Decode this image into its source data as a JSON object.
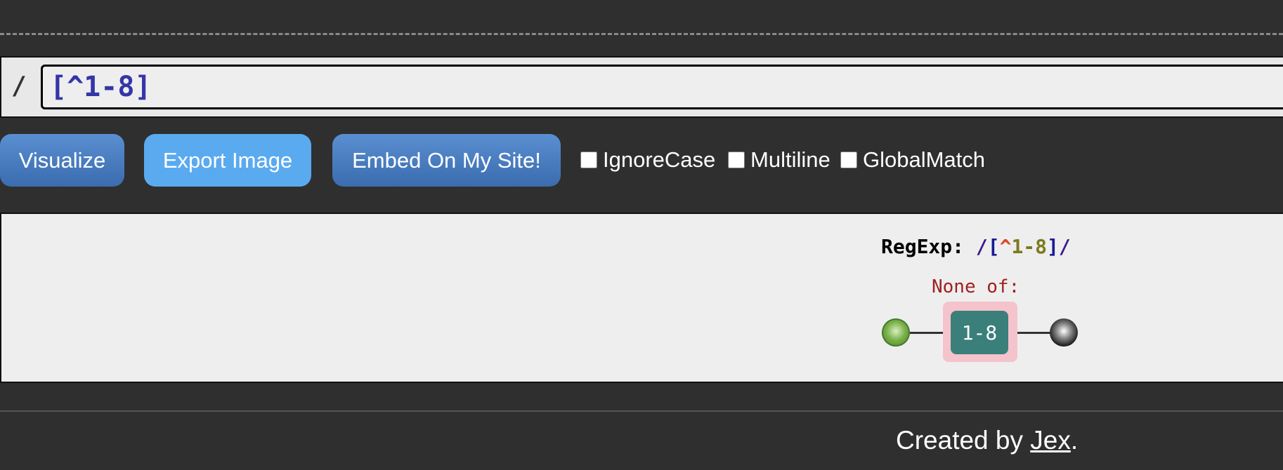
{
  "input": {
    "slash": "/",
    "value": "[^1-8]"
  },
  "buttons": {
    "visualize": "Visualize",
    "export": "Export Image",
    "embed": "Embed On My Site!"
  },
  "options": {
    "ignore_case": {
      "label": "IgnoreCase",
      "checked": false
    },
    "multiline": {
      "label": "Multiline",
      "checked": false
    },
    "global_match": {
      "label": "GlobalMatch",
      "checked": false
    }
  },
  "diagram": {
    "regexp_prefix": "RegExp: ",
    "open_slash": "/",
    "open_bracket": "[",
    "caret": "^",
    "range_text": "1-8",
    "close_bracket": "]",
    "close_slash": "/",
    "set_caption": "None of:",
    "range_node": "1-8"
  },
  "footer": {
    "prefix": "Created by ",
    "author": "Jex",
    "suffix": "."
  },
  "colors": {
    "background": "#2f2f2f",
    "panel": "#eeeeee",
    "button_dark": "#3a6cae",
    "button_light": "#5aaaf0",
    "set_box": "#f4c3cc",
    "range_node": "#3a7f7a"
  }
}
